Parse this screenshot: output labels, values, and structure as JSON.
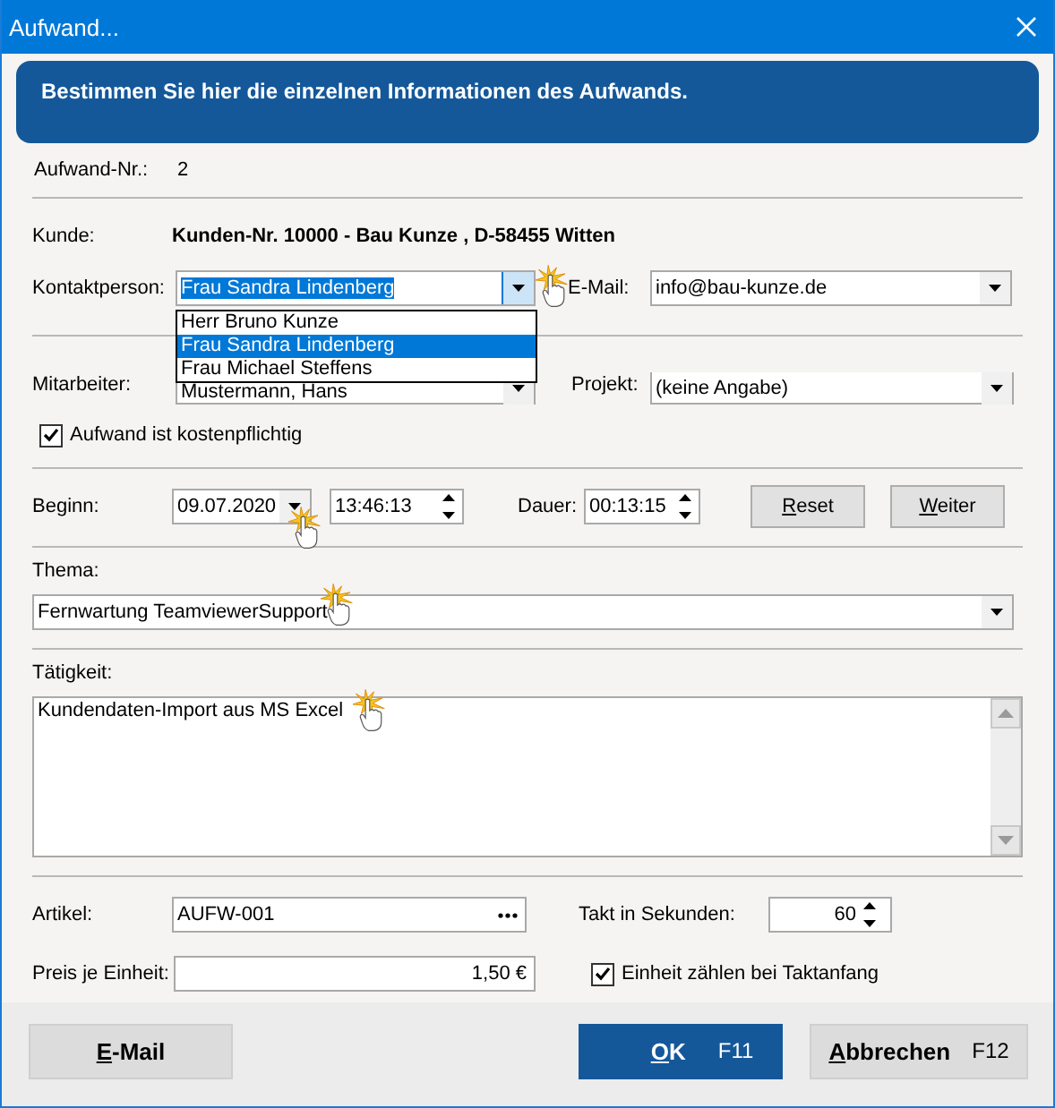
{
  "window": {
    "title": "Aufwand..."
  },
  "banner": "Bestimmen Sie hier die einzelnen Informationen des Aufwands.",
  "aufwand_nr": {
    "label": "Aufwand-Nr.:",
    "value": "2"
  },
  "kunde": {
    "label": "Kunde:",
    "value": "Kunden-Nr. 10000 - Bau Kunze , D-58455  Witten"
  },
  "kontaktperson": {
    "label": "Kontaktperson:",
    "value": "Frau Sandra Lindenberg",
    "options": [
      {
        "label": "Herr Bruno Kunze",
        "selected": false
      },
      {
        "label": "Frau Sandra Lindenberg",
        "selected": true
      },
      {
        "label": "Frau Michael Steffens",
        "selected": false
      }
    ]
  },
  "email": {
    "label": "E-Mail:",
    "value": "info@bau-kunze.de"
  },
  "mitarbeiter": {
    "label": "Mitarbeiter:",
    "value": "Mustermann, Hans"
  },
  "projekt": {
    "label": "Projekt:",
    "value": "(keine Angabe)"
  },
  "kostenpflichtig": {
    "label": "Aufwand ist kostenpflichtig",
    "checked": true
  },
  "beginn": {
    "label": "Beginn:",
    "date": "09.07.2020",
    "time": "13:46:13"
  },
  "dauer": {
    "label": "Dauer:",
    "value": "00:13:15"
  },
  "row_buttons": [
    "Reset",
    "Weiter"
  ],
  "thema": {
    "label": "Thema:",
    "value": "Fernwartung TeamviewerSupport"
  },
  "taetigkeit": {
    "label": "Tätigkeit:",
    "value": "Kundendaten-Import aus MS Excel"
  },
  "artikel": {
    "label": "Artikel:",
    "value": "AUFW-001"
  },
  "takt": {
    "label": "Takt in Sekunden:",
    "value": "60"
  },
  "preis": {
    "label": "Preis je Einheit:",
    "value": "1,50 €"
  },
  "taktanfang": {
    "label": "Einheit zählen bei Taktanfang",
    "checked": true
  },
  "footer": [
    {
      "label": "E-Mail",
      "kind": "secondary"
    },
    {
      "label": "OK",
      "shortcut": "F11",
      "kind": "primary"
    },
    {
      "label": "Abbrechen",
      "shortcut": "F12",
      "kind": "secondary"
    }
  ]
}
